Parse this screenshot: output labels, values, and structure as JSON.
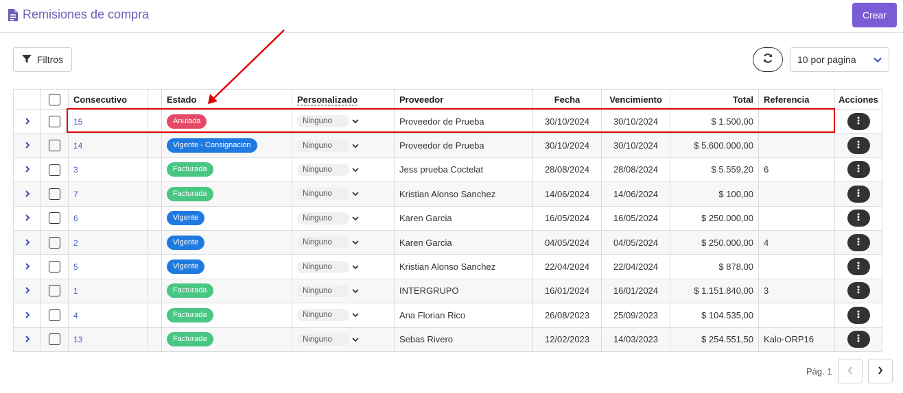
{
  "header": {
    "title": "Remisiones de compra",
    "create_label": "Crear"
  },
  "toolbar": {
    "filters_label": "Filtros",
    "per_page_label": "10 por pagina"
  },
  "table": {
    "columns": [
      "Consecutivo",
      "Estado",
      "Personalizado",
      "Proveedor",
      "Fecha",
      "Vencimiento",
      "Total",
      "Referencia",
      "Acciones"
    ],
    "rows": [
      {
        "consecutivo": "15",
        "estado": "Anulada",
        "estado_type": "anulada",
        "personalizado": "Ninguno",
        "proveedor": "Proveedor de Prueba",
        "fecha": "30/10/2024",
        "vencimiento": "30/10/2024",
        "total": "$ 1.500,00",
        "referencia": ""
      },
      {
        "consecutivo": "14",
        "estado": "Vigente - Consignacion",
        "estado_type": "vigente",
        "personalizado": "Ninguno",
        "proveedor": "Proveedor de Prueba",
        "fecha": "30/10/2024",
        "vencimiento": "30/10/2024",
        "total": "$ 5.600.000,00",
        "referencia": ""
      },
      {
        "consecutivo": "3",
        "estado": "Facturada",
        "estado_type": "facturada",
        "personalizado": "Ninguno",
        "proveedor": "Jess prueba Coctelat",
        "fecha": "28/08/2024",
        "vencimiento": "28/08/2024",
        "total": "$ 5.559,20",
        "referencia": "6"
      },
      {
        "consecutivo": "7",
        "estado": "Facturada",
        "estado_type": "facturada",
        "personalizado": "Ninguno",
        "proveedor": "Kristian Alonso Sanchez",
        "fecha": "14/06/2024",
        "vencimiento": "14/06/2024",
        "total": "$ 100,00",
        "referencia": ""
      },
      {
        "consecutivo": "6",
        "estado": "Vigente",
        "estado_type": "vigente",
        "personalizado": "Ninguno",
        "proveedor": "Karen Garcia",
        "fecha": "16/05/2024",
        "vencimiento": "16/05/2024",
        "total": "$ 250.000,00",
        "referencia": ""
      },
      {
        "consecutivo": "2",
        "estado": "Vigente",
        "estado_type": "vigente",
        "personalizado": "Ninguno",
        "proveedor": "Karen Garcia",
        "fecha": "04/05/2024",
        "vencimiento": "04/05/2024",
        "total": "$ 250.000,00",
        "referencia": "4"
      },
      {
        "consecutivo": "5",
        "estado": "Vigente",
        "estado_type": "vigente",
        "personalizado": "Ninguno",
        "proveedor": "Kristian Alonso Sanchez",
        "fecha": "22/04/2024",
        "vencimiento": "22/04/2024",
        "total": "$ 878,00",
        "referencia": ""
      },
      {
        "consecutivo": "1",
        "estado": "Facturada",
        "estado_type": "facturada",
        "personalizado": "Ninguno",
        "proveedor": "INTERGRUPO",
        "fecha": "16/01/2024",
        "vencimiento": "16/01/2024",
        "total": "$ 1.151.840,00",
        "referencia": "3"
      },
      {
        "consecutivo": "4",
        "estado": "Facturada",
        "estado_type": "facturada",
        "personalizado": "Ninguno",
        "proveedor": "Ana Florian Rico",
        "fecha": "26/08/2023",
        "vencimiento": "25/09/2023",
        "total": "$ 104.535,00",
        "referencia": ""
      },
      {
        "consecutivo": "13",
        "estado": "Facturada",
        "estado_type": "facturada",
        "personalizado": "Ninguno",
        "proveedor": "Sebas Rivero",
        "fecha": "12/02/2023",
        "vencimiento": "14/03/2023",
        "total": "$ 254.551,50",
        "referencia": "Kalo-ORP16"
      }
    ]
  },
  "pagination": {
    "page_label": "Pág. 1"
  },
  "icons": {
    "title": "document-icon",
    "filter": "filter-icon",
    "refresh": "refresh-icon",
    "per_page": "chevron-down-icon",
    "row_expand": "chevron-right-icon",
    "row_actions": "kebab-icon",
    "prev": "chevron-left-icon",
    "next": "chevron-right-icon"
  },
  "colors": {
    "accent": "#7a5cd6",
    "title": "#6f5bb8",
    "anulada": "#e34a67",
    "vigente": "#1f7ae0",
    "facturada": "#48c684",
    "annotation": "#e00000"
  }
}
